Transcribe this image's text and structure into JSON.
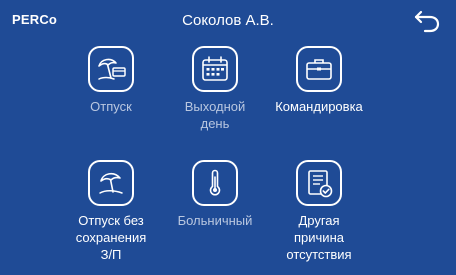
{
  "header": {
    "logo": "PERCo",
    "title": "Соколов А.В.",
    "back_icon": "back-arrow-icon"
  },
  "tiles": [
    {
      "label": "Отпуск",
      "icon": "beach-umbrella-card-icon"
    },
    {
      "label": "Выходной\nдень",
      "icon": "calendar-icon"
    },
    {
      "label": "Командировка",
      "icon": "briefcase-icon"
    },
    {
      "label": "Отпуск без\nсохранения\nЗ/П",
      "icon": "beach-umbrella-icon"
    },
    {
      "label": "Больничный",
      "icon": "thermometer-icon"
    },
    {
      "label": "Другая\nпричина\nотсутствия",
      "icon": "document-check-icon"
    }
  ],
  "colors": {
    "background": "#1f4b96",
    "label_dim": "#b9c7e0",
    "label_bright": "#ffffff"
  }
}
